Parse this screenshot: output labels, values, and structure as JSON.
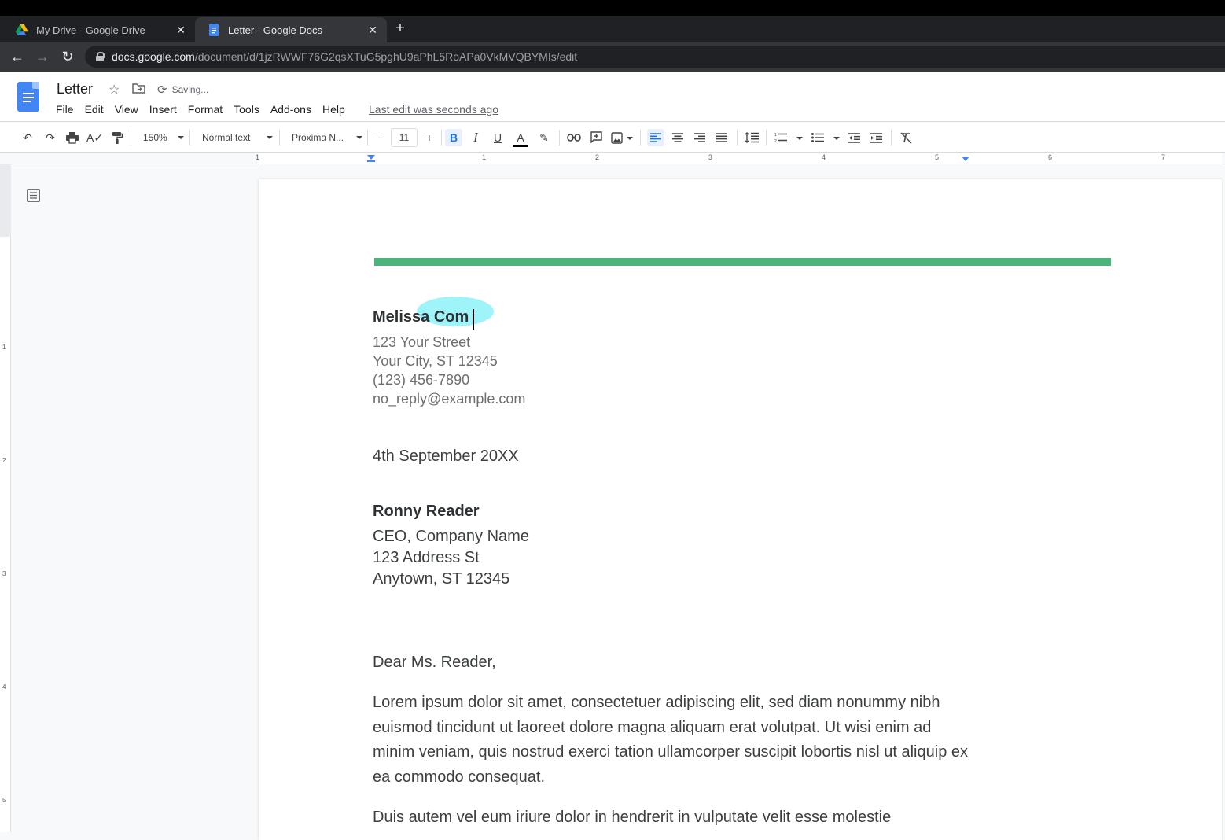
{
  "browser": {
    "tabs": [
      {
        "title": "My Drive - Google Drive",
        "active": false
      },
      {
        "title": "Letter - Google Docs",
        "active": true
      }
    ],
    "url_host": "docs.google.com",
    "url_path": "/document/d/1jzRWWF76G2qsXTuG5pghU9aPhL5RoAPa0VkMVQBYMIs/edit"
  },
  "doc": {
    "title": "Letter",
    "status": "Saving...",
    "last_edit": "Last edit was seconds ago",
    "menu": [
      "File",
      "Edit",
      "View",
      "Insert",
      "Format",
      "Tools",
      "Add-ons",
      "Help"
    ]
  },
  "toolbar": {
    "zoom": "150%",
    "style": "Normal text",
    "font": "Proxima N...",
    "font_size": "11"
  },
  "ruler": {
    "h_numbers": [
      "1",
      "1",
      "2",
      "3",
      "4",
      "5",
      "6",
      "7"
    ],
    "v_numbers": [
      "1",
      "2",
      "3",
      "4",
      "5"
    ]
  },
  "letter": {
    "sender_name": "Melissa Com",
    "sender_street": "123 Your Street",
    "sender_city": "Your City, ST 12345",
    "sender_phone": "(123) 456-7890",
    "sender_email": "no_reply@example.com",
    "date": "4th September 20XX",
    "recipient_name": "Ronny Reader",
    "recipient_title": "CEO, Company Name",
    "recipient_street": "123 Address St",
    "recipient_city": "Anytown, ST 12345",
    "greeting": "Dear Ms. Reader,",
    "paragraph1": "Lorem ipsum dolor sit amet, consectetuer adipiscing elit, sed diam nonummy nibh euismod tincidunt ut laoreet dolore magna aliquam erat volutpat. Ut wisi enim ad minim veniam, quis nostrud exerci tation ullamcorper suscipit lobortis nisl ut aliquip ex ea commodo consequat.",
    "paragraph2": "Duis autem vel eum iriure dolor in hendrerit in vulputate velit esse molestie"
  },
  "colors": {
    "accent_bar": "#4bb47b",
    "cursor_highlight": "#50ebf5",
    "docs_blue": "#4285f4"
  }
}
